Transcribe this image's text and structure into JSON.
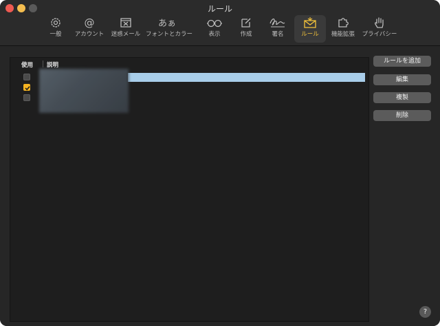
{
  "window": {
    "title": "ルール"
  },
  "toolbar": {
    "items": [
      {
        "label": "一般",
        "icon": "gear-icon"
      },
      {
        "label": "アカウント",
        "icon": "at-icon"
      },
      {
        "label": "迷惑メール",
        "icon": "junk-tray-icon"
      },
      {
        "label": "フォントとカラー",
        "icon": "font-aa-icon"
      },
      {
        "label": "表示",
        "icon": "glasses-icon"
      },
      {
        "label": "作成",
        "icon": "compose-icon"
      },
      {
        "label": "署名",
        "icon": "signature-icon"
      },
      {
        "label": "ルール",
        "icon": "rules-envelope-icon",
        "active": true
      },
      {
        "label": "機能拡張",
        "icon": "puzzle-icon"
      },
      {
        "label": "プライバシー",
        "icon": "hand-icon"
      }
    ],
    "active_color": "#f5c43a"
  },
  "table": {
    "columns": {
      "use": "使用",
      "description": "説明"
    },
    "rows": [
      {
        "enabled": false,
        "selected": true
      },
      {
        "enabled": true,
        "selected": false
      },
      {
        "enabled": false,
        "selected": false
      }
    ],
    "selection_color": "#a8cde9"
  },
  "buttons": {
    "add_rule": "ルールを追加",
    "edit": "編集",
    "duplicate": "複製",
    "delete": "削除"
  },
  "help": {
    "label": "?"
  }
}
